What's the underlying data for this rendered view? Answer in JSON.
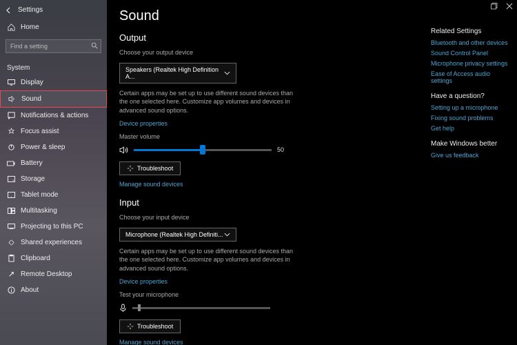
{
  "app": {
    "title": "Settings"
  },
  "sidebar": {
    "home": "Home",
    "search_placeholder": "Find a setting",
    "group": "System",
    "items": [
      {
        "label": "Display"
      },
      {
        "label": "Sound"
      },
      {
        "label": "Notifications & actions"
      },
      {
        "label": "Focus assist"
      },
      {
        "label": "Power & sleep"
      },
      {
        "label": "Battery"
      },
      {
        "label": "Storage"
      },
      {
        "label": "Tablet mode"
      },
      {
        "label": "Multitasking"
      },
      {
        "label": "Projecting to this PC"
      },
      {
        "label": "Shared experiences"
      },
      {
        "label": "Clipboard"
      },
      {
        "label": "Remote Desktop"
      },
      {
        "label": "About"
      }
    ]
  },
  "main": {
    "title": "Sound",
    "output": {
      "heading": "Output",
      "choose": "Choose your output device",
      "device": "Speakers (Realtek High Definition A...",
      "note": "Certain apps may be set up to use different sound devices than the one selected here. Customize app volumes and devices in advanced sound options.",
      "device_props": "Device properties",
      "master": "Master volume",
      "volume": "50",
      "troubleshoot": "Troubleshoot",
      "manage": "Manage sound devices"
    },
    "input": {
      "heading": "Input",
      "choose": "Choose your input device",
      "device": "Microphone (Realtek High Definiti...",
      "note": "Certain apps may be set up to use different sound devices than the one selected here. Customize app volumes and devices in advanced sound options.",
      "device_props": "Device properties",
      "test": "Test your microphone",
      "troubleshoot": "Troubleshoot",
      "manage": "Manage sound devices"
    }
  },
  "right": {
    "related_h": "Related Settings",
    "related": [
      "Bluetooth and other devices",
      "Sound Control Panel",
      "Microphone privacy settings",
      "Ease of Access audio settings"
    ],
    "question_h": "Have a question?",
    "question": [
      "Setting up a microphone",
      "Fixing sound problems",
      "Get help"
    ],
    "better_h": "Make Windows better",
    "better": [
      "Give us feedback"
    ]
  }
}
